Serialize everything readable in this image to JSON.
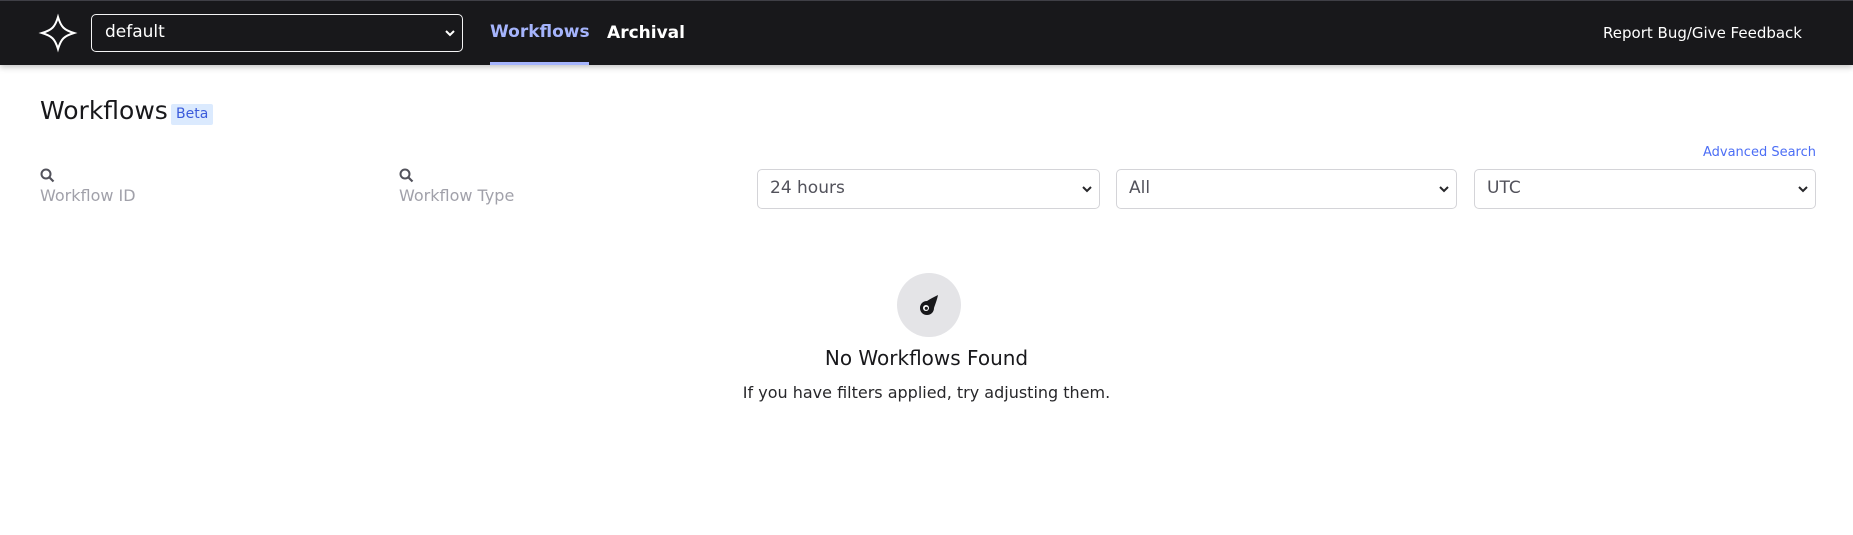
{
  "header": {
    "logo_icon": "temporal-logo-icon",
    "namespace": {
      "selected": "default",
      "icon": "chevron-down-icon"
    },
    "nav": [
      {
        "label": "Workflows",
        "active": true
      },
      {
        "label": "Archival",
        "active": false
      }
    ],
    "feedback_label": "Report Bug/Give Feedback"
  },
  "page": {
    "title": "Workflows",
    "badge": "Beta",
    "advanced_search": "Advanced Search"
  },
  "filters": {
    "workflow_id": {
      "placeholder": "Workflow ID",
      "icon": "search-icon"
    },
    "workflow_type": {
      "placeholder": "Workflow Type",
      "icon": "search-icon"
    },
    "time_range": {
      "selected": "24 hours"
    },
    "status": {
      "selected": "All"
    },
    "timezone": {
      "selected": "UTC"
    }
  },
  "empty_state": {
    "icon": "comet-icon",
    "title": "No Workflows Found",
    "message": "If you have filters applied, try adjusting them."
  },
  "colors": {
    "header_bg": "#18181b",
    "active_nav": "#a5b4fc",
    "link": "#4c6ef5",
    "badge_bg": "#dbeafe"
  }
}
